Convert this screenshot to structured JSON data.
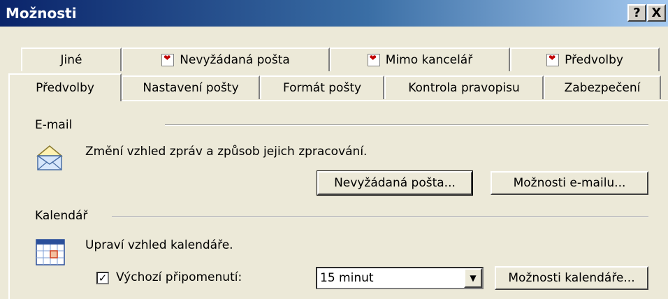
{
  "window": {
    "title": "Možnosti",
    "help_glyph": "?",
    "close_glyph": "X"
  },
  "tabs": {
    "row1": [
      {
        "label": "Jiné"
      },
      {
        "label": "Nevyžádaná pošta",
        "icon": "addin-icon"
      },
      {
        "label": "Mimo kancelář",
        "icon": "addin-icon"
      },
      {
        "label": "Předvolby",
        "icon": "addin-icon"
      }
    ],
    "row2": [
      {
        "label": "Předvolby"
      },
      {
        "label": "Nastavení pošty"
      },
      {
        "label": "Formát pošty"
      },
      {
        "label": "Kontrola pravopisu"
      },
      {
        "label": "Zabezpečení"
      }
    ],
    "active": "Předvolby"
  },
  "email": {
    "section_label": "E-mail",
    "description": "Změní vzhled zpráv a způsob jejich zpracování.",
    "junk_button": "Nevyžádaná pošta...",
    "options_button": "Možnosti e-mailu...",
    "icon": "envelope-icon"
  },
  "calendar": {
    "section_label": "Kalendář",
    "description": "Upraví vzhled kalendáře.",
    "reminder_checkbox_label": "Výchozí připomenutí:",
    "reminder_checked": true,
    "reminder_value": "15 minut",
    "options_button": "Možnosti kalendáře...",
    "icon": "calendar-icon"
  }
}
